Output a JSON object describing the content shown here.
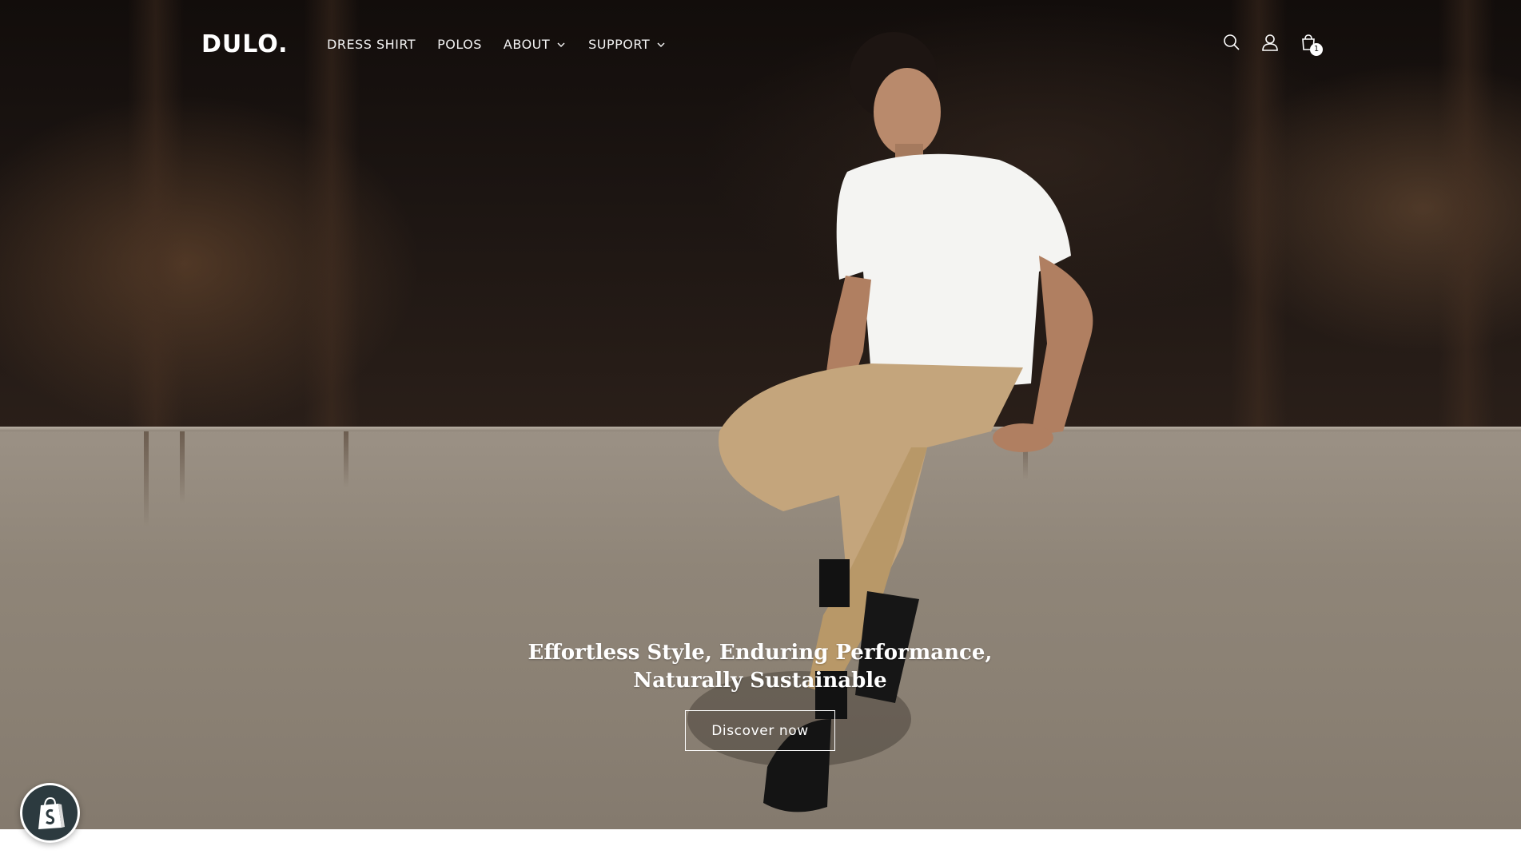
{
  "header": {
    "logo": "DULO.",
    "nav": [
      {
        "label": "DRESS SHIRT",
        "has_dropdown": false
      },
      {
        "label": "POLOS",
        "has_dropdown": false
      },
      {
        "label": "ABOUT",
        "has_dropdown": true
      },
      {
        "label": "SUPPORT",
        "has_dropdown": true
      }
    ],
    "icons": [
      "search-icon",
      "account-icon",
      "cart-icon"
    ],
    "cart_count": "1"
  },
  "hero": {
    "heading": "Effortless Style, Enduring Performance, Naturally Sustainable",
    "button_label": "Discover now"
  },
  "badge": {
    "icon": "shopify-icon"
  },
  "colors": {
    "text_on_hero": "#ffffff",
    "badge_background": "#2c3a3f"
  }
}
